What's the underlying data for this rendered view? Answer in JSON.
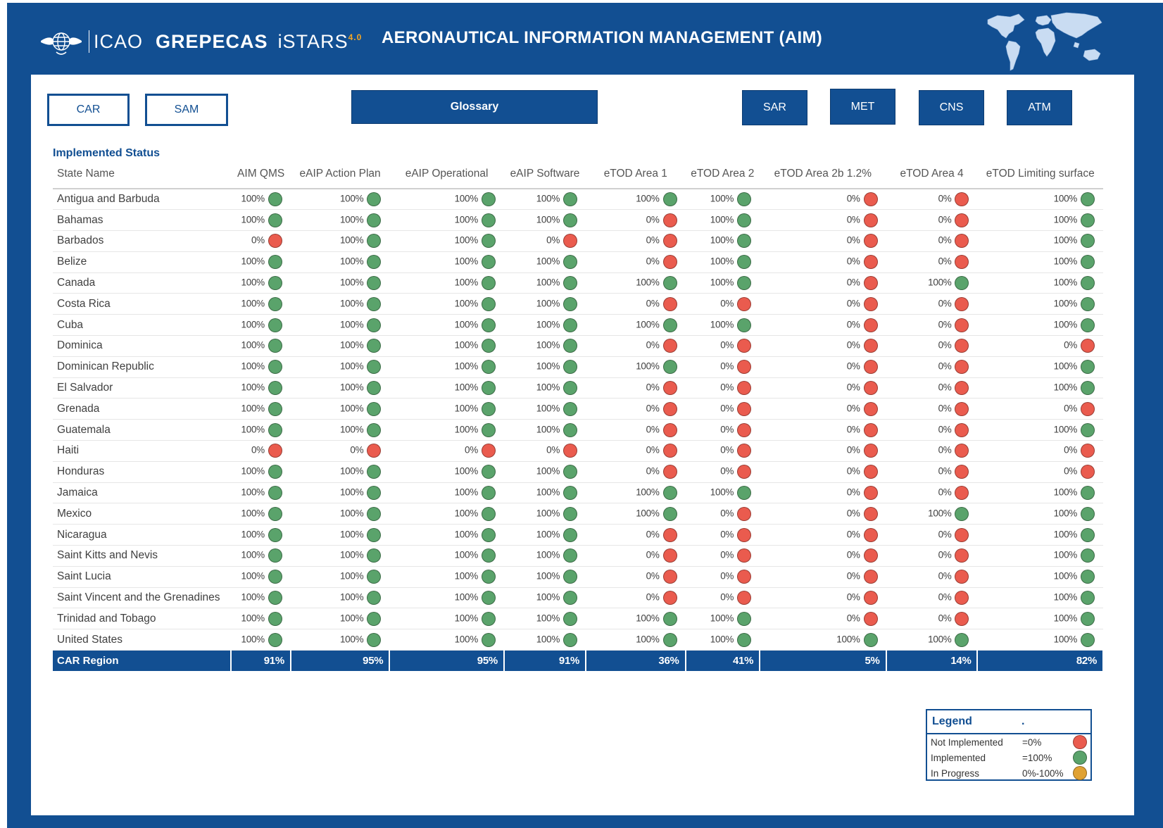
{
  "header": {
    "logo_icao": "ICAO",
    "logo_grepecas": "GREPECAS",
    "logo_istars": "iSTARS",
    "logo_version": "4.0",
    "title": "AERONAUTICAL INFORMATION MANAGEMENT (AIM)"
  },
  "nav": {
    "car": "CAR",
    "sam": "SAM",
    "glossary": "Glossary",
    "sar": "SAR",
    "met": "MET",
    "cns": "CNS",
    "atm": "ATM"
  },
  "section_title": "Implemented Status",
  "table": {
    "headers": [
      "State Name",
      "AIM QMS",
      "eAIP Action Plan",
      "eAIP Operational",
      "eAIP Software",
      "eTOD Area 1",
      "eTOD Area 2",
      "eTOD Area 2b 1.2%",
      "eTOD Area 4",
      "eTOD Limiting surface"
    ],
    "rows": [
      {
        "state": "Antigua and Barbuda",
        "values": [
          "100%",
          "100%",
          "100%",
          "100%",
          "100%",
          "100%",
          "0%",
          "0%",
          "100%"
        ]
      },
      {
        "state": "Bahamas",
        "values": [
          "100%",
          "100%",
          "100%",
          "100%",
          "0%",
          "100%",
          "0%",
          "0%",
          "100%"
        ]
      },
      {
        "state": "Barbados",
        "values": [
          "0%",
          "100%",
          "100%",
          "0%",
          "0%",
          "100%",
          "0%",
          "0%",
          "100%"
        ]
      },
      {
        "state": "Belize",
        "values": [
          "100%",
          "100%",
          "100%",
          "100%",
          "0%",
          "100%",
          "0%",
          "0%",
          "100%"
        ]
      },
      {
        "state": "Canada",
        "values": [
          "100%",
          "100%",
          "100%",
          "100%",
          "100%",
          "100%",
          "0%",
          "100%",
          "100%"
        ]
      },
      {
        "state": "Costa Rica",
        "values": [
          "100%",
          "100%",
          "100%",
          "100%",
          "0%",
          "0%",
          "0%",
          "0%",
          "100%"
        ]
      },
      {
        "state": "Cuba",
        "values": [
          "100%",
          "100%",
          "100%",
          "100%",
          "100%",
          "100%",
          "0%",
          "0%",
          "100%"
        ]
      },
      {
        "state": "Dominica",
        "values": [
          "100%",
          "100%",
          "100%",
          "100%",
          "0%",
          "0%",
          "0%",
          "0%",
          "0%"
        ]
      },
      {
        "state": "Dominican Republic",
        "values": [
          "100%",
          "100%",
          "100%",
          "100%",
          "100%",
          "0%",
          "0%",
          "0%",
          "100%"
        ]
      },
      {
        "state": "El Salvador",
        "values": [
          "100%",
          "100%",
          "100%",
          "100%",
          "0%",
          "0%",
          "0%",
          "0%",
          "100%"
        ]
      },
      {
        "state": "Grenada",
        "values": [
          "100%",
          "100%",
          "100%",
          "100%",
          "0%",
          "0%",
          "0%",
          "0%",
          "0%"
        ]
      },
      {
        "state": "Guatemala",
        "values": [
          "100%",
          "100%",
          "100%",
          "100%",
          "0%",
          "0%",
          "0%",
          "0%",
          "100%"
        ]
      },
      {
        "state": "Haiti",
        "values": [
          "0%",
          "0%",
          "0%",
          "0%",
          "0%",
          "0%",
          "0%",
          "0%",
          "0%"
        ]
      },
      {
        "state": "Honduras",
        "values": [
          "100%",
          "100%",
          "100%",
          "100%",
          "0%",
          "0%",
          "0%",
          "0%",
          "0%"
        ]
      },
      {
        "state": "Jamaica",
        "values": [
          "100%",
          "100%",
          "100%",
          "100%",
          "100%",
          "100%",
          "0%",
          "0%",
          "100%"
        ]
      },
      {
        "state": "Mexico",
        "values": [
          "100%",
          "100%",
          "100%",
          "100%",
          "100%",
          "0%",
          "0%",
          "100%",
          "100%"
        ]
      },
      {
        "state": "Nicaragua",
        "values": [
          "100%",
          "100%",
          "100%",
          "100%",
          "0%",
          "0%",
          "0%",
          "0%",
          "100%"
        ]
      },
      {
        "state": "Saint Kitts and Nevis",
        "values": [
          "100%",
          "100%",
          "100%",
          "100%",
          "0%",
          "0%",
          "0%",
          "0%",
          "100%"
        ]
      },
      {
        "state": "Saint Lucia",
        "values": [
          "100%",
          "100%",
          "100%",
          "100%",
          "0%",
          "0%",
          "0%",
          "0%",
          "100%"
        ]
      },
      {
        "state": "Saint Vincent and the Grenadines",
        "values": [
          "100%",
          "100%",
          "100%",
          "100%",
          "0%",
          "0%",
          "0%",
          "0%",
          "100%"
        ]
      },
      {
        "state": "Trinidad and Tobago",
        "values": [
          "100%",
          "100%",
          "100%",
          "100%",
          "100%",
          "100%",
          "0%",
          "0%",
          "100%"
        ]
      },
      {
        "state": "United States",
        "values": [
          "100%",
          "100%",
          "100%",
          "100%",
          "100%",
          "100%",
          "100%",
          "100%",
          "100%"
        ]
      }
    ],
    "total": {
      "label": "CAR Region",
      "values": [
        "91%",
        "95%",
        "95%",
        "91%",
        "36%",
        "41%",
        "5%",
        "14%",
        "82%"
      ]
    }
  },
  "legend": {
    "title": "Legend",
    "dot": ".",
    "items": [
      {
        "label": "Not Implemented",
        "value": "=0%",
        "color": "#ea5b4e"
      },
      {
        "label": "Implemented",
        "value": "=100%",
        "color": "#5aa36b"
      },
      {
        "label": "In Progress",
        "value": "0%-100%",
        "color": "#e0a234"
      }
    ]
  },
  "colors": {
    "brand": "#124f92",
    "implemented": "#5aa36b",
    "not_implemented": "#ea5b4e",
    "in_progress": "#e0a234"
  }
}
